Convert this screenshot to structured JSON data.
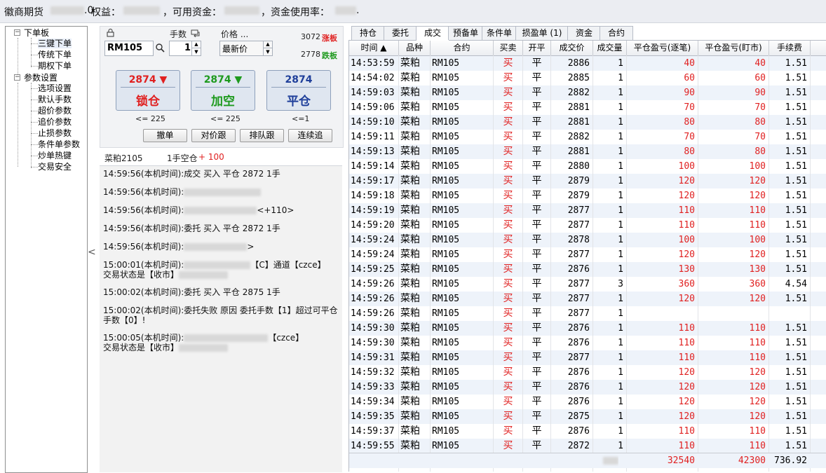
{
  "topbar": {
    "company": "徽商期货",
    "account_suffix": ".0",
    "equity_label": "权益：",
    "available_label": "，可用资金：",
    "usage_label": "，资金使用率：",
    "tail": "."
  },
  "tree": {
    "root1": "下单板",
    "root1_items": [
      "三键下单",
      "传统下单",
      "期权下单"
    ],
    "root2": "参数设置",
    "root2_items": [
      "选项设置",
      "默认手数",
      "超价参数",
      "追价参数",
      "止损参数",
      "条件单参数",
      "炒单热键",
      "交易安全"
    ],
    "expand_symbol": "−"
  },
  "collapse_arrow": "<",
  "order": {
    "lock_icon": "lock-icon",
    "contract": "RM105",
    "qty_label": "手数",
    "qty_value": "1",
    "price_label": "价格 ...",
    "price_value": "最新价",
    "limit_up_price": "3072",
    "limit_up_label": "涨板",
    "limit_down_price": "2778",
    "limit_down_label": "跌板",
    "buttons": [
      {
        "price": "2874",
        "arrow": "▼",
        "label": "锁仓",
        "limit": "<= 225"
      },
      {
        "price": "2874",
        "arrow": "▼",
        "label": "加空",
        "limit": "<= 225"
      },
      {
        "price": "2874",
        "arrow": "",
        "label": "平仓",
        "limit": "<=1"
      }
    ],
    "actions": [
      "撤单",
      "对价跟",
      "排队跟",
      "连续追"
    ]
  },
  "position": {
    "name": "菜粕2105",
    "info": "1手空仓",
    "pnl": "+ 100"
  },
  "log": [
    "14:59:56(本机时间):成交 买入 平仓 2872 1手",
    "14:59:56(本机时间):",
    "14:59:56(本机时间):",
    "14:59:56(本机时间):委托 买入 平仓 2872 1手",
    "14:59:56(本机时间):",
    "15:00:01(本机时间):",
    "15:00:02(本机时间):委托 买入 平仓 2875 1手",
    "15:00:02(本机时间):委托失败 原因 委托手数【1】超过可平仓",
    "15:00:05(本机时间):"
  ],
  "log_extra": {
    "l3_tail": "<+110>",
    "l5_tail": ">",
    "l6_tail1": "通道【czce】",
    "l6_tail1_prefix": "【C】",
    "l6_line2": "交易状态是【收市】",
    "l8_line2": "手数【0】!",
    "l9_tail": "【czce】",
    "l9_line2": "交易状态是【收市】"
  },
  "tabs": [
    "持仓",
    "委托",
    "成交",
    "预备单",
    "条件单",
    "损盈单 (1)",
    "资金",
    "合约"
  ],
  "active_tab": 2,
  "table": {
    "columns": [
      "时间 ▲",
      "品种",
      "合约",
      "买卖",
      "开平",
      "成交价",
      "成交量",
      "平仓盈亏(逐笔)",
      "平仓盈亏(盯市)",
      "手续费"
    ],
    "rows": [
      [
        "14:53:59",
        "菜粕",
        "RM105",
        "买",
        "平",
        "2886",
        "1",
        "40",
        "40",
        "1.51"
      ],
      [
        "14:54:02",
        "菜粕",
        "RM105",
        "买",
        "平",
        "2885",
        "1",
        "60",
        "60",
        "1.51"
      ],
      [
        "14:59:03",
        "菜粕",
        "RM105",
        "买",
        "平",
        "2882",
        "1",
        "90",
        "90",
        "1.51"
      ],
      [
        "14:59:06",
        "菜粕",
        "RM105",
        "买",
        "平",
        "2881",
        "1",
        "70",
        "70",
        "1.51"
      ],
      [
        "14:59:10",
        "菜粕",
        "RM105",
        "买",
        "平",
        "2881",
        "1",
        "80",
        "80",
        "1.51"
      ],
      [
        "14:59:11",
        "菜粕",
        "RM105",
        "买",
        "平",
        "2882",
        "1",
        "70",
        "70",
        "1.51"
      ],
      [
        "14:59:13",
        "菜粕",
        "RM105",
        "买",
        "平",
        "2881",
        "1",
        "80",
        "80",
        "1.51"
      ],
      [
        "14:59:14",
        "菜粕",
        "RM105",
        "买",
        "平",
        "2880",
        "1",
        "100",
        "100",
        "1.51"
      ],
      [
        "14:59:17",
        "菜粕",
        "RM105",
        "买",
        "平",
        "2879",
        "1",
        "120",
        "120",
        "1.51"
      ],
      [
        "14:59:18",
        "菜粕",
        "RM105",
        "买",
        "平",
        "2879",
        "1",
        "120",
        "120",
        "1.51"
      ],
      [
        "14:59:19",
        "菜粕",
        "RM105",
        "买",
        "平",
        "2877",
        "1",
        "110",
        "110",
        "1.51"
      ],
      [
        "14:59:20",
        "菜粕",
        "RM105",
        "买",
        "平",
        "2877",
        "1",
        "110",
        "110",
        "1.51"
      ],
      [
        "14:59:24",
        "菜粕",
        "RM105",
        "买",
        "平",
        "2878",
        "1",
        "100",
        "100",
        "1.51"
      ],
      [
        "14:59:24",
        "菜粕",
        "RM105",
        "买",
        "平",
        "2877",
        "1",
        "120",
        "120",
        "1.51"
      ],
      [
        "14:59:25",
        "菜粕",
        "RM105",
        "买",
        "平",
        "2876",
        "1",
        "130",
        "130",
        "1.51"
      ],
      [
        "14:59:26",
        "菜粕",
        "RM105",
        "买",
        "平",
        "2877",
        "3",
        "360",
        "360",
        "4.54"
      ],
      [
        "14:59:26",
        "菜粕",
        "RM105",
        "买",
        "平",
        "2877",
        "1",
        "120",
        "120",
        "1.51"
      ],
      [
        "14:59:26",
        "菜粕",
        "RM105",
        "买",
        "平",
        "2877",
        "1",
        "",
        "",
        ""
      ],
      [
        "14:59:30",
        "菜粕",
        "RM105",
        "买",
        "平",
        "2876",
        "1",
        "110",
        "110",
        "1.51"
      ],
      [
        "14:59:30",
        "菜粕",
        "RM105",
        "买",
        "平",
        "2876",
        "1",
        "110",
        "110",
        "1.51"
      ],
      [
        "14:59:31",
        "菜粕",
        "RM105",
        "买",
        "平",
        "2877",
        "1",
        "110",
        "110",
        "1.51"
      ],
      [
        "14:59:32",
        "菜粕",
        "RM105",
        "买",
        "平",
        "2876",
        "1",
        "120",
        "120",
        "1.51"
      ],
      [
        "14:59:33",
        "菜粕",
        "RM105",
        "买",
        "平",
        "2876",
        "1",
        "120",
        "120",
        "1.51"
      ],
      [
        "14:59:34",
        "菜粕",
        "RM105",
        "买",
        "平",
        "2876",
        "1",
        "120",
        "120",
        "1.51"
      ],
      [
        "14:59:35",
        "菜粕",
        "RM105",
        "买",
        "平",
        "2875",
        "1",
        "120",
        "120",
        "1.51"
      ],
      [
        "14:59:37",
        "菜粕",
        "RM105",
        "买",
        "平",
        "2876",
        "1",
        "110",
        "110",
        "1.51"
      ],
      [
        "14:59:55",
        "菜粕",
        "RM105",
        "买",
        "平",
        "2872",
        "1",
        "110",
        "110",
        "1.51"
      ]
    ],
    "totals": {
      "volume": "30",
      "pnl_trade": "32540",
      "pnl_mtm": "42300",
      "fee": "736.92"
    }
  },
  "colors": {
    "red": "#e02020",
    "green": "#1e9a1e",
    "blue": "#1f3f9a"
  }
}
